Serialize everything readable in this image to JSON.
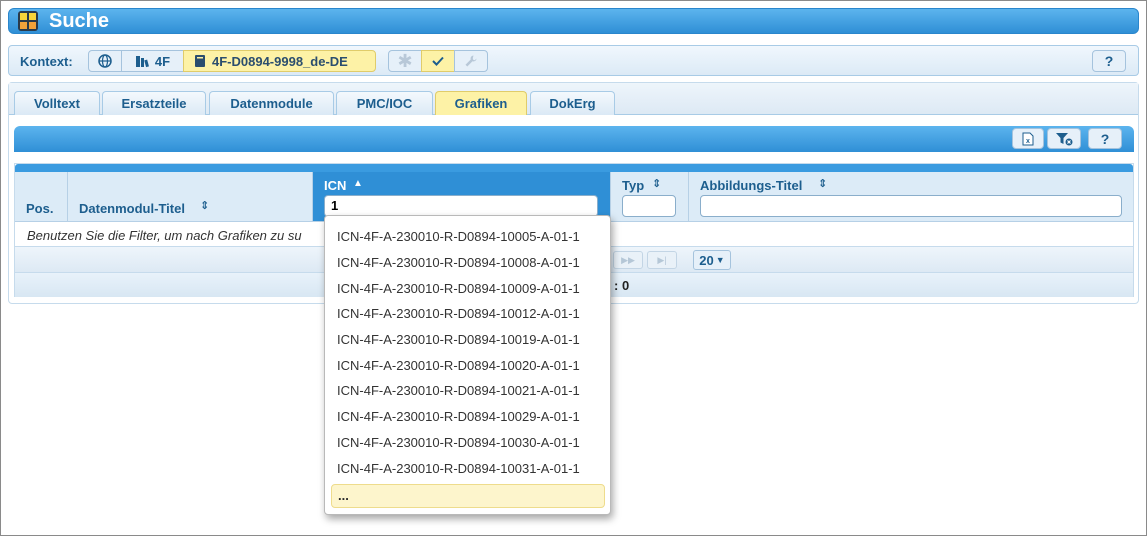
{
  "window": {
    "title": "Suche"
  },
  "context": {
    "label": "Kontext:",
    "model": "4F",
    "datamodule": "4F-D0894-9998_de-DE",
    "help": "?"
  },
  "tabs": [
    {
      "label": "Volltext"
    },
    {
      "label": "Ersatzteile"
    },
    {
      "label": "Datenmodule"
    },
    {
      "label": "PMC/IOC"
    },
    {
      "label": "Grafiken",
      "active": true
    },
    {
      "label": "DokErg"
    }
  ],
  "toolbar": {
    "help": "?"
  },
  "grid": {
    "columns": [
      {
        "label": "Pos."
      },
      {
        "label": "Datenmodul-Titel"
      },
      {
        "label": "ICN"
      },
      {
        "label": "Typ"
      },
      {
        "label": "Abbildungs-Titel"
      }
    ],
    "icn_filter_value": "1",
    "message": "Benutzen Sie die Filter, um nach Grafiken zu su",
    "page_size": "20",
    "status_fragment": ": 0"
  },
  "dropdown": {
    "items": [
      "ICN-4F-A-230010-R-D0894-10005-A-01-1",
      "ICN-4F-A-230010-R-D0894-10008-A-01-1",
      "ICN-4F-A-230010-R-D0894-10009-A-01-1",
      "ICN-4F-A-230010-R-D0894-10012-A-01-1",
      "ICN-4F-A-230010-R-D0894-10019-A-01-1",
      "ICN-4F-A-230010-R-D0894-10020-A-01-1",
      "ICN-4F-A-230010-R-D0894-10021-A-01-1",
      "ICN-4F-A-230010-R-D0894-10029-A-01-1",
      "ICN-4F-A-230010-R-D0894-10030-A-01-1",
      "ICN-4F-A-230010-R-D0894-10031-A-01-1"
    ],
    "more": "..."
  },
  "colors": {
    "accent_blue": "#2f8fd6",
    "active_yellow": "#fdf2a6",
    "label_blue": "#1d5e8e"
  }
}
